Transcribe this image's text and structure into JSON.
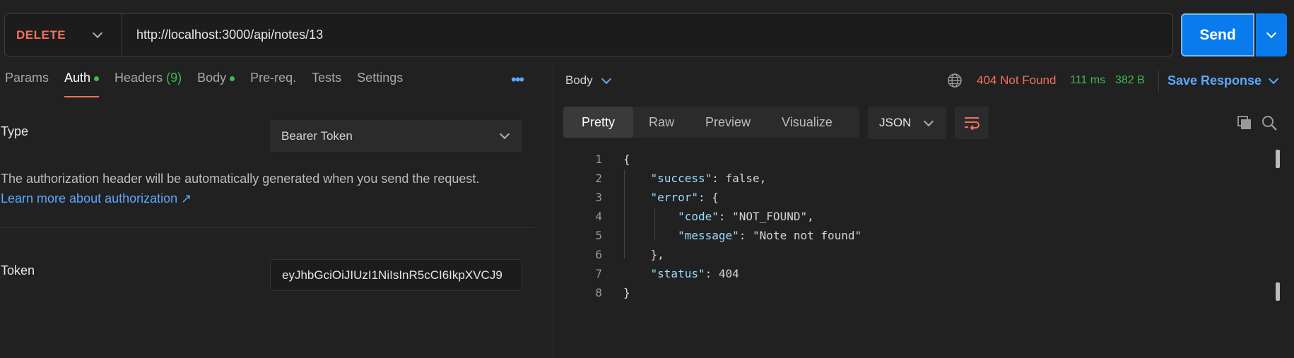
{
  "request": {
    "method": "DELETE",
    "url": "http://localhost:3000/api/notes/13",
    "send_label": "Send"
  },
  "request_tabs": [
    {
      "label": "Params",
      "active": false
    },
    {
      "label": "Auth",
      "active": true,
      "dot": true
    },
    {
      "label": "Headers",
      "count": "(9)",
      "active": false
    },
    {
      "label": "Body",
      "active": false,
      "dot": true
    },
    {
      "label": "Pre-req.",
      "active": false
    },
    {
      "label": "Tests",
      "active": false
    },
    {
      "label": "Settings",
      "active": false
    }
  ],
  "more_label": "•••",
  "auth": {
    "type_label": "Type",
    "type_value": "Bearer Token",
    "description": "The authorization header will be automatically generated when you send the request.",
    "learn_more": "Learn more about authorization ↗",
    "token_label": "Token",
    "token_value": "eyJhbGciOiJIUzI1NiIsInR5cCI6IkpXVCJ9"
  },
  "response": {
    "body_label": "Body",
    "status": "404 Not Found",
    "time": "111 ms",
    "size": "382 B",
    "save_label": "Save Response",
    "view_tabs": [
      "Pretty",
      "Raw",
      "Preview",
      "Visualize"
    ],
    "active_view": "Pretty",
    "format": "JSON"
  },
  "code_lines": [
    {
      "n": "1",
      "text": "{"
    },
    {
      "n": "2",
      "text": "    \"success\": false,"
    },
    {
      "n": "3",
      "text": "    \"error\": {"
    },
    {
      "n": "4",
      "text": "        \"code\": \"NOT_FOUND\","
    },
    {
      "n": "5",
      "text": "        \"message\": \"Note not found\""
    },
    {
      "n": "6",
      "text": "    },"
    },
    {
      "n": "7",
      "text": "    \"status\": 404"
    },
    {
      "n": "8",
      "text": "}"
    }
  ],
  "colors": {
    "accent": "#097bed",
    "method": "#f0715c",
    "success": "#3fb950",
    "link": "#5ca8ff",
    "error": "#f0715c"
  }
}
